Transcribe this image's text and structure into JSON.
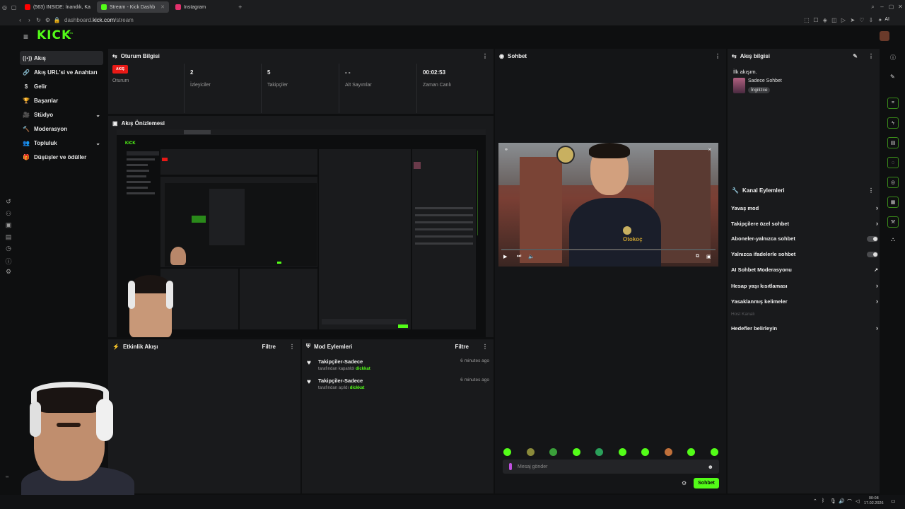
{
  "browser": {
    "tabs": [
      {
        "label": "(563) INSIDE: İnandık, Ka",
        "color": "#ff0000"
      },
      {
        "label": "Stream - Kick Dashb",
        "color": "#53fc18",
        "active": true
      },
      {
        "label": "Instagram",
        "color": "#e1306c"
      }
    ],
    "new_tab": "+",
    "url_prefix": "dashboard.",
    "url_domain": "kick.com",
    "url_path": "/stream",
    "ai_label": "AI"
  },
  "header": {
    "logo": "KICK",
    "beta": "BETA"
  },
  "sidebar": {
    "items": [
      {
        "label": "Akış",
        "icon": "((•))",
        "active": true
      },
      {
        "label": "Akış URL'si ve Anahtarı",
        "icon": "🔗"
      },
      {
        "label": "Gelir",
        "icon": "$"
      },
      {
        "label": "Başarılar",
        "icon": "🏆"
      },
      {
        "label": "Stüdyo",
        "icon": "🎥",
        "chevron": "⌄"
      },
      {
        "label": "Moderasyon",
        "icon": "🔨"
      },
      {
        "label": "Topluluk",
        "icon": "👥",
        "chevron": "⌄"
      },
      {
        "label": "Düşüşler ve ödüller",
        "icon": "🎁"
      }
    ]
  },
  "session": {
    "title": "Oturum Bilgisi",
    "live_badge": "AKIŞ",
    "session_label": "Oturum",
    "viewers_value": "2",
    "viewers_label": "İzleyiciler",
    "followers_value": "5",
    "followers_label": "Takipçiler",
    "subs_value": "- -",
    "subs_label": "Alt Sayımlar",
    "time_value": "00:02:53",
    "time_label": "Zaman Canlı"
  },
  "preview": {
    "title": "Akış Önizlemesi"
  },
  "activity": {
    "title": "Etkinlik Akışı",
    "filter": "Filtre"
  },
  "mod_actions": {
    "title": "Mod Eylemleri",
    "filter": "Filtre",
    "items": [
      {
        "title": "Takipçiler-Sadece",
        "prefix": "tarafından kapatıldı",
        "user": "dickkat",
        "time": "6 minutes ago"
      },
      {
        "title": "Takipçiler-Sadece",
        "prefix": "tarafından açıldı",
        "user": "dickkat",
        "time": "6 minutes ago"
      }
    ]
  },
  "chat": {
    "title": "Sohbet",
    "placeholder": "Mesaj gönder",
    "send_label": "Sohbet",
    "video_overlay_text": "Otokoç"
  },
  "stream_info": {
    "title": "Akış bilgisi",
    "stream_title": "İlk akışım.",
    "category": "Sadece Sohbet",
    "language_tag": "İngilizce"
  },
  "channel_actions": {
    "title": "Kanal Eylemleri",
    "items": [
      {
        "label": "Yavaş mod",
        "control": "chevron"
      },
      {
        "label": "Takipçilere özel sohbet",
        "control": "chevron"
      },
      {
        "label": "Aboneler-yalnızca sohbet",
        "control": "toggle"
      },
      {
        "label": "Yalnızca ifadelerle sohbet",
        "control": "toggle"
      },
      {
        "label": "AI Sohbet Moderasyonu",
        "control": "link"
      },
      {
        "label": "Hesap yaşı kısıtlaması",
        "control": "chevron"
      },
      {
        "label": "Yasaklanmış kelimeler",
        "control": "chevron"
      },
      {
        "label": "Host Kanalı",
        "control": "none",
        "disabled": true
      },
      {
        "label": "Hedefler belirleyin",
        "control": "chevron"
      }
    ]
  },
  "taskbar": {
    "time": "00:08",
    "date": "17.02.2026"
  }
}
